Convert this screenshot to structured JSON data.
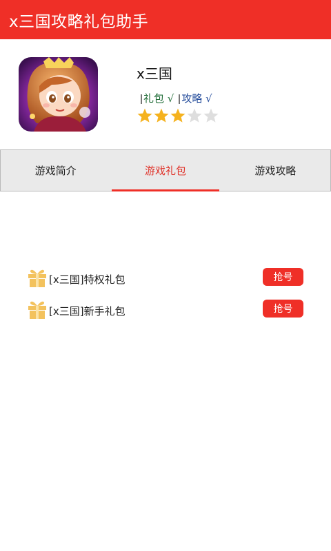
{
  "app_bar": {
    "title": "x三国攻略礼包助手",
    "color": "#ef2f27"
  },
  "game": {
    "icon": "game-avatar-icon",
    "name": "x三国",
    "tags": [
      {
        "label": "礼包 √",
        "color": "#1e6b35"
      },
      {
        "label": "攻略 √",
        "color": "#224a9a"
      }
    ],
    "rating": 3,
    "rating_max": 5
  },
  "tabs": [
    {
      "label": "游戏简介",
      "active": false
    },
    {
      "label": "游戏礼包",
      "active": true
    },
    {
      "label": "游戏攻略",
      "active": false
    }
  ],
  "gifts": [
    {
      "icon": "gift-box-icon",
      "name": "[x三国]特权礼包",
      "button_label": "抢号"
    },
    {
      "icon": "gift-box-icon",
      "name": "[x三国]新手礼包",
      "button_label": "抢号"
    }
  ],
  "colors": {
    "accent": "#ef2f27",
    "star_filled": "#f5b21e",
    "star_empty": "#dedede",
    "gift_icon": "#f3c25d"
  }
}
